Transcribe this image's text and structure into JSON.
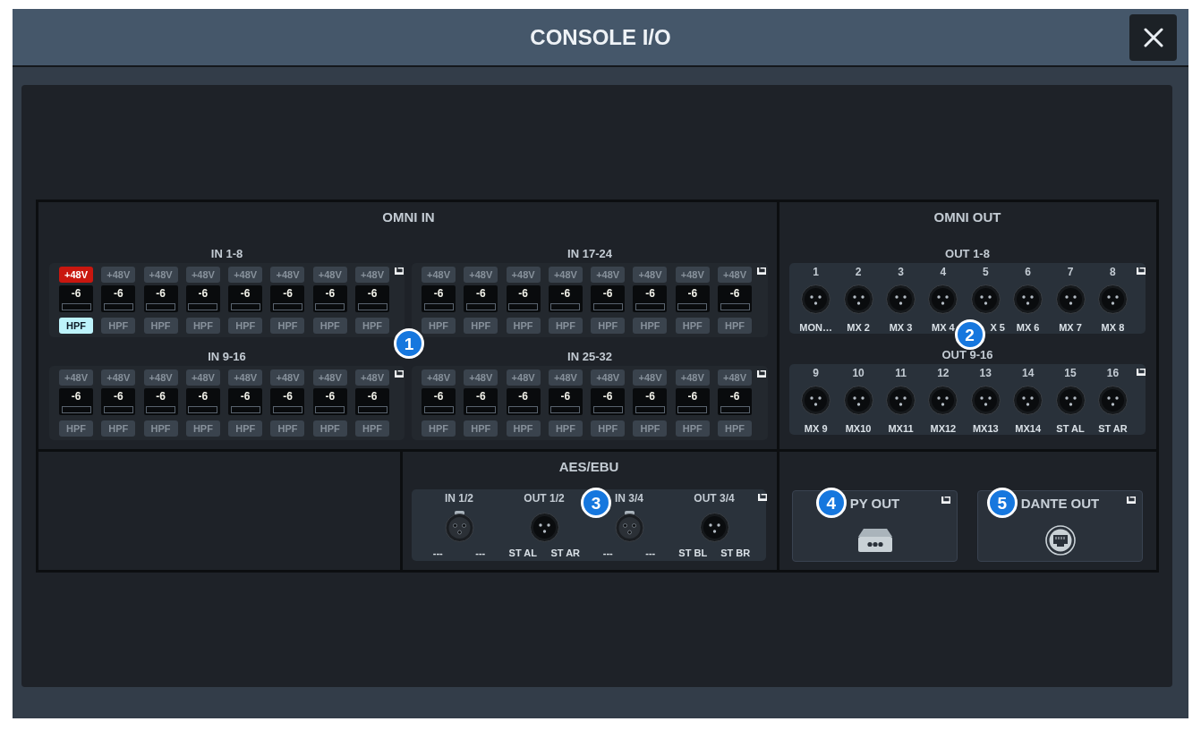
{
  "window": {
    "title": "CONSOLE I/O"
  },
  "omni_in": {
    "title": "OMNI IN",
    "callout": "1",
    "groups": [
      {
        "title": "IN 1-8",
        "channels": [
          {
            "phantom": "+48V",
            "phantom_on": true,
            "gain": "-6",
            "hpf": "HPF",
            "hpf_on": true
          },
          {
            "phantom": "+48V",
            "phantom_on": false,
            "gain": "-6",
            "hpf": "HPF",
            "hpf_on": false
          },
          {
            "phantom": "+48V",
            "phantom_on": false,
            "gain": "-6",
            "hpf": "HPF",
            "hpf_on": false
          },
          {
            "phantom": "+48V",
            "phantom_on": false,
            "gain": "-6",
            "hpf": "HPF",
            "hpf_on": false
          },
          {
            "phantom": "+48V",
            "phantom_on": false,
            "gain": "-6",
            "hpf": "HPF",
            "hpf_on": false
          },
          {
            "phantom": "+48V",
            "phantom_on": false,
            "gain": "-6",
            "hpf": "HPF",
            "hpf_on": false
          },
          {
            "phantom": "+48V",
            "phantom_on": false,
            "gain": "-6",
            "hpf": "HPF",
            "hpf_on": false
          },
          {
            "phantom": "+48V",
            "phantom_on": false,
            "gain": "-6",
            "hpf": "HPF",
            "hpf_on": false
          }
        ]
      },
      {
        "title": "IN 17-24",
        "channels": [
          {
            "phantom": "+48V",
            "phantom_on": false,
            "gain": "-6",
            "hpf": "HPF",
            "hpf_on": false
          },
          {
            "phantom": "+48V",
            "phantom_on": false,
            "gain": "-6",
            "hpf": "HPF",
            "hpf_on": false
          },
          {
            "phantom": "+48V",
            "phantom_on": false,
            "gain": "-6",
            "hpf": "HPF",
            "hpf_on": false
          },
          {
            "phantom": "+48V",
            "phantom_on": false,
            "gain": "-6",
            "hpf": "HPF",
            "hpf_on": false
          },
          {
            "phantom": "+48V",
            "phantom_on": false,
            "gain": "-6",
            "hpf": "HPF",
            "hpf_on": false
          },
          {
            "phantom": "+48V",
            "phantom_on": false,
            "gain": "-6",
            "hpf": "HPF",
            "hpf_on": false
          },
          {
            "phantom": "+48V",
            "phantom_on": false,
            "gain": "-6",
            "hpf": "HPF",
            "hpf_on": false
          },
          {
            "phantom": "+48V",
            "phantom_on": false,
            "gain": "-6",
            "hpf": "HPF",
            "hpf_on": false
          }
        ]
      },
      {
        "title": "IN 9-16",
        "channels": [
          {
            "phantom": "+48V",
            "phantom_on": false,
            "gain": "-6",
            "hpf": "HPF",
            "hpf_on": false
          },
          {
            "phantom": "+48V",
            "phantom_on": false,
            "gain": "-6",
            "hpf": "HPF",
            "hpf_on": false
          },
          {
            "phantom": "+48V",
            "phantom_on": false,
            "gain": "-6",
            "hpf": "HPF",
            "hpf_on": false
          },
          {
            "phantom": "+48V",
            "phantom_on": false,
            "gain": "-6",
            "hpf": "HPF",
            "hpf_on": false
          },
          {
            "phantom": "+48V",
            "phantom_on": false,
            "gain": "-6",
            "hpf": "HPF",
            "hpf_on": false
          },
          {
            "phantom": "+48V",
            "phantom_on": false,
            "gain": "-6",
            "hpf": "HPF",
            "hpf_on": false
          },
          {
            "phantom": "+48V",
            "phantom_on": false,
            "gain": "-6",
            "hpf": "HPF",
            "hpf_on": false
          },
          {
            "phantom": "+48V",
            "phantom_on": false,
            "gain": "-6",
            "hpf": "HPF",
            "hpf_on": false
          }
        ]
      },
      {
        "title": "IN 25-32",
        "channels": [
          {
            "phantom": "+48V",
            "phantom_on": false,
            "gain": "-6",
            "hpf": "HPF",
            "hpf_on": false
          },
          {
            "phantom": "+48V",
            "phantom_on": false,
            "gain": "-6",
            "hpf": "HPF",
            "hpf_on": false
          },
          {
            "phantom": "+48V",
            "phantom_on": false,
            "gain": "-6",
            "hpf": "HPF",
            "hpf_on": false
          },
          {
            "phantom": "+48V",
            "phantom_on": false,
            "gain": "-6",
            "hpf": "HPF",
            "hpf_on": false
          },
          {
            "phantom": "+48V",
            "phantom_on": false,
            "gain": "-6",
            "hpf": "HPF",
            "hpf_on": false
          },
          {
            "phantom": "+48V",
            "phantom_on": false,
            "gain": "-6",
            "hpf": "HPF",
            "hpf_on": false
          },
          {
            "phantom": "+48V",
            "phantom_on": false,
            "gain": "-6",
            "hpf": "HPF",
            "hpf_on": false
          },
          {
            "phantom": "+48V",
            "phantom_on": false,
            "gain": "-6",
            "hpf": "HPF",
            "hpf_on": false
          }
        ]
      }
    ]
  },
  "omni_out": {
    "title": "OMNI OUT",
    "groups": [
      {
        "title": "OUT 1-8",
        "ports": [
          {
            "number": "1",
            "name": "MON…"
          },
          {
            "number": "2",
            "name": "MX 2"
          },
          {
            "number": "3",
            "name": "MX 3"
          },
          {
            "number": "4",
            "name": "MX 4"
          },
          {
            "number": "5",
            "name": "X 5",
            "callout": "2"
          },
          {
            "number": "6",
            "name": "MX 6"
          },
          {
            "number": "7",
            "name": "MX 7"
          },
          {
            "number": "8",
            "name": "MX 8"
          }
        ]
      },
      {
        "title": "OUT 9-16",
        "ports": [
          {
            "number": "9",
            "name": "MX 9"
          },
          {
            "number": "10",
            "name": "MX10"
          },
          {
            "number": "11",
            "name": "MX11"
          },
          {
            "number": "12",
            "name": "MX12"
          },
          {
            "number": "13",
            "name": "MX13"
          },
          {
            "number": "14",
            "name": "MX14"
          },
          {
            "number": "15",
            "name": "ST AL"
          },
          {
            "number": "16",
            "name": "ST AR"
          }
        ]
      }
    ]
  },
  "aes_ebu": {
    "title": "AES/EBU",
    "ports": [
      {
        "title": "IN 1/2",
        "kind": "input",
        "channels": [
          "---",
          "---"
        ]
      },
      {
        "title": "OUT 1/2",
        "kind": "output",
        "channels": [
          "ST AL",
          "ST AR"
        ]
      },
      {
        "title": "IN 3/4",
        "kind": "input",
        "channels": [
          "---",
          "---"
        ],
        "callout": "3"
      },
      {
        "title": "OUT 3/4",
        "kind": "output",
        "channels": [
          "ST BL",
          "ST BR"
        ]
      }
    ]
  },
  "outputs": [
    {
      "label": "PY OUT",
      "kind": "device",
      "callout": "4"
    },
    {
      "label": "DANTE OUT",
      "kind": "network",
      "callout": "5"
    }
  ]
}
